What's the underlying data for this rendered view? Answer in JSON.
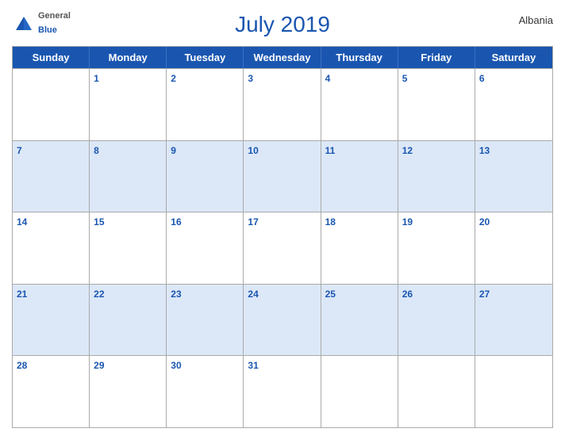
{
  "header": {
    "title": "July 2019",
    "country": "Albania",
    "logo_general": "General",
    "logo_blue": "Blue"
  },
  "calendar": {
    "days_of_week": [
      "Sunday",
      "Monday",
      "Tuesday",
      "Wednesday",
      "Thursday",
      "Friday",
      "Saturday"
    ],
    "weeks": [
      [
        "",
        "1",
        "2",
        "3",
        "4",
        "5",
        "6"
      ],
      [
        "7",
        "8",
        "9",
        "10",
        "11",
        "12",
        "13"
      ],
      [
        "14",
        "15",
        "16",
        "17",
        "18",
        "19",
        "20"
      ],
      [
        "21",
        "22",
        "23",
        "24",
        "25",
        "26",
        "27"
      ],
      [
        "28",
        "29",
        "30",
        "31",
        "",
        "",
        ""
      ]
    ]
  }
}
